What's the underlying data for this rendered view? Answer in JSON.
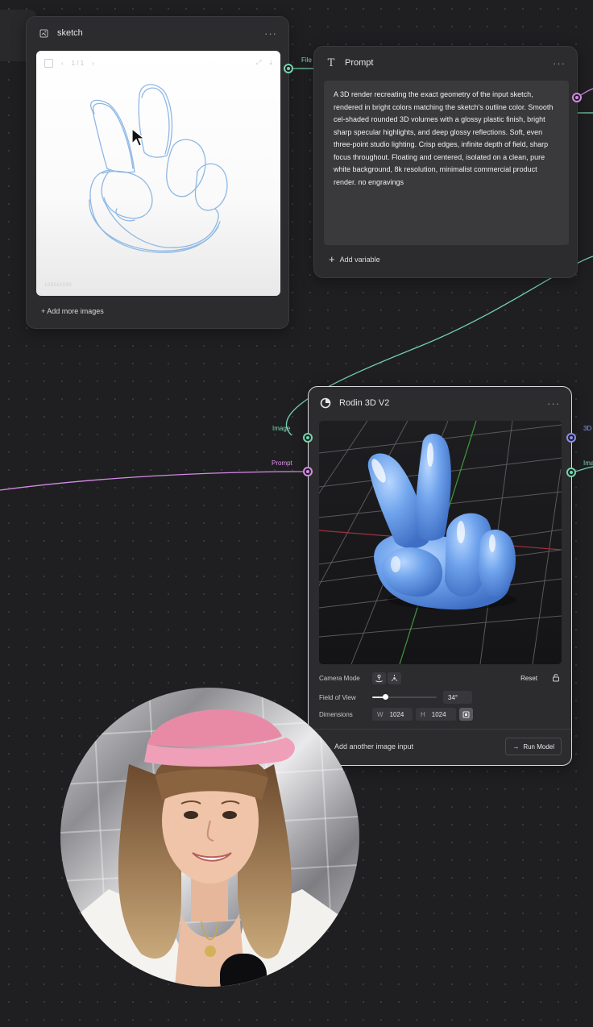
{
  "sketch_node": {
    "title": "sketch",
    "pager": "1 / 1",
    "resolution": "1080x1080",
    "add_more": "+ Add more images",
    "output_port_label": "File"
  },
  "prompt_node": {
    "title": "Prompt",
    "text": "A 3D render recreating the exact geometry of the input sketch, rendered in bright colors matching the sketch's outline color. Smooth cel-shaded rounded 3D volumes with a glossy plastic finish, bright sharp specular highlights, and deep glossy reflections. Soft, even three-point studio lighting. Crisp edges, infinite depth of field, sharp focus throughout. Floating and centered, isolated on a clean, pure white background, 8k resolution, minimalist commercial product render. no engravings",
    "add_variable": "Add variable"
  },
  "rodin_node": {
    "title": "Rodin 3D V2",
    "input_image_label": "Image",
    "input_prompt_label": "Prompt",
    "output_3d_label": "3D",
    "output_image_label": "Ima",
    "camera_mode_label": "Camera Mode",
    "reset_label": "Reset",
    "fov_label": "Field of View",
    "fov_value": "34°",
    "fov_fraction": 0.2,
    "dimensions_label": "Dimensions",
    "width_prefix": "W",
    "width_value": "1024",
    "height_prefix": "H",
    "height_value": "1024",
    "add_image_input": "Add another image input",
    "run_model": "Run Model"
  },
  "colors": {
    "port_green": "#74d3ad",
    "port_pink": "#d58ae6",
    "port_blue": "#8b8df2",
    "sketch_line": "#8fb8e4",
    "model_blue": "#5b93e6"
  },
  "icons": [
    "image-file-icon",
    "text-t-icon",
    "more-dots-icon",
    "plus-icon",
    "rodin-logo-icon",
    "orbit-icon",
    "pan-icon",
    "lock-icon",
    "aspect-lock-icon",
    "arrow-right-icon",
    "cursor-arrow-icon",
    "download-icon",
    "fit-icon"
  ]
}
